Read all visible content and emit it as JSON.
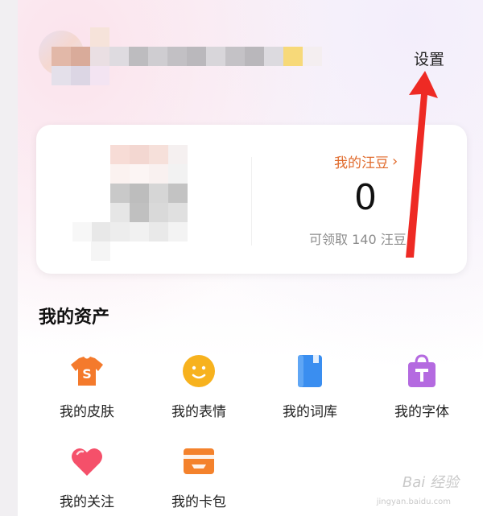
{
  "header": {
    "settings_label": "设置"
  },
  "wallet": {
    "beans_link_label": "我的汪豆",
    "beans_count": "0",
    "claimable_text": "可领取 140 汪豆"
  },
  "assets": {
    "title": "我的资产",
    "items": [
      {
        "label": "我的皮肤",
        "icon": "tshirt-icon",
        "color": "#f47a2c"
      },
      {
        "label": "我的表情",
        "icon": "smiley-face-icon",
        "color": "#f7b21e"
      },
      {
        "label": "我的词库",
        "icon": "book-icon",
        "color": "#3a8ef0"
      },
      {
        "label": "我的字体",
        "icon": "shopping-bag-t-icon",
        "color": "#b46ae0"
      },
      {
        "label": "我的关注",
        "icon": "heart-icon",
        "color": "#f5506a"
      },
      {
        "label": "我的卡包",
        "icon": "card-wallet-icon",
        "color": "#f4822c"
      }
    ]
  },
  "watermark": {
    "text": "Bai 经验",
    "sub": "jingyan.baidu.com"
  },
  "colors": {
    "accent_orange": "#e06a2b",
    "annotation_red": "#ee2a24"
  }
}
